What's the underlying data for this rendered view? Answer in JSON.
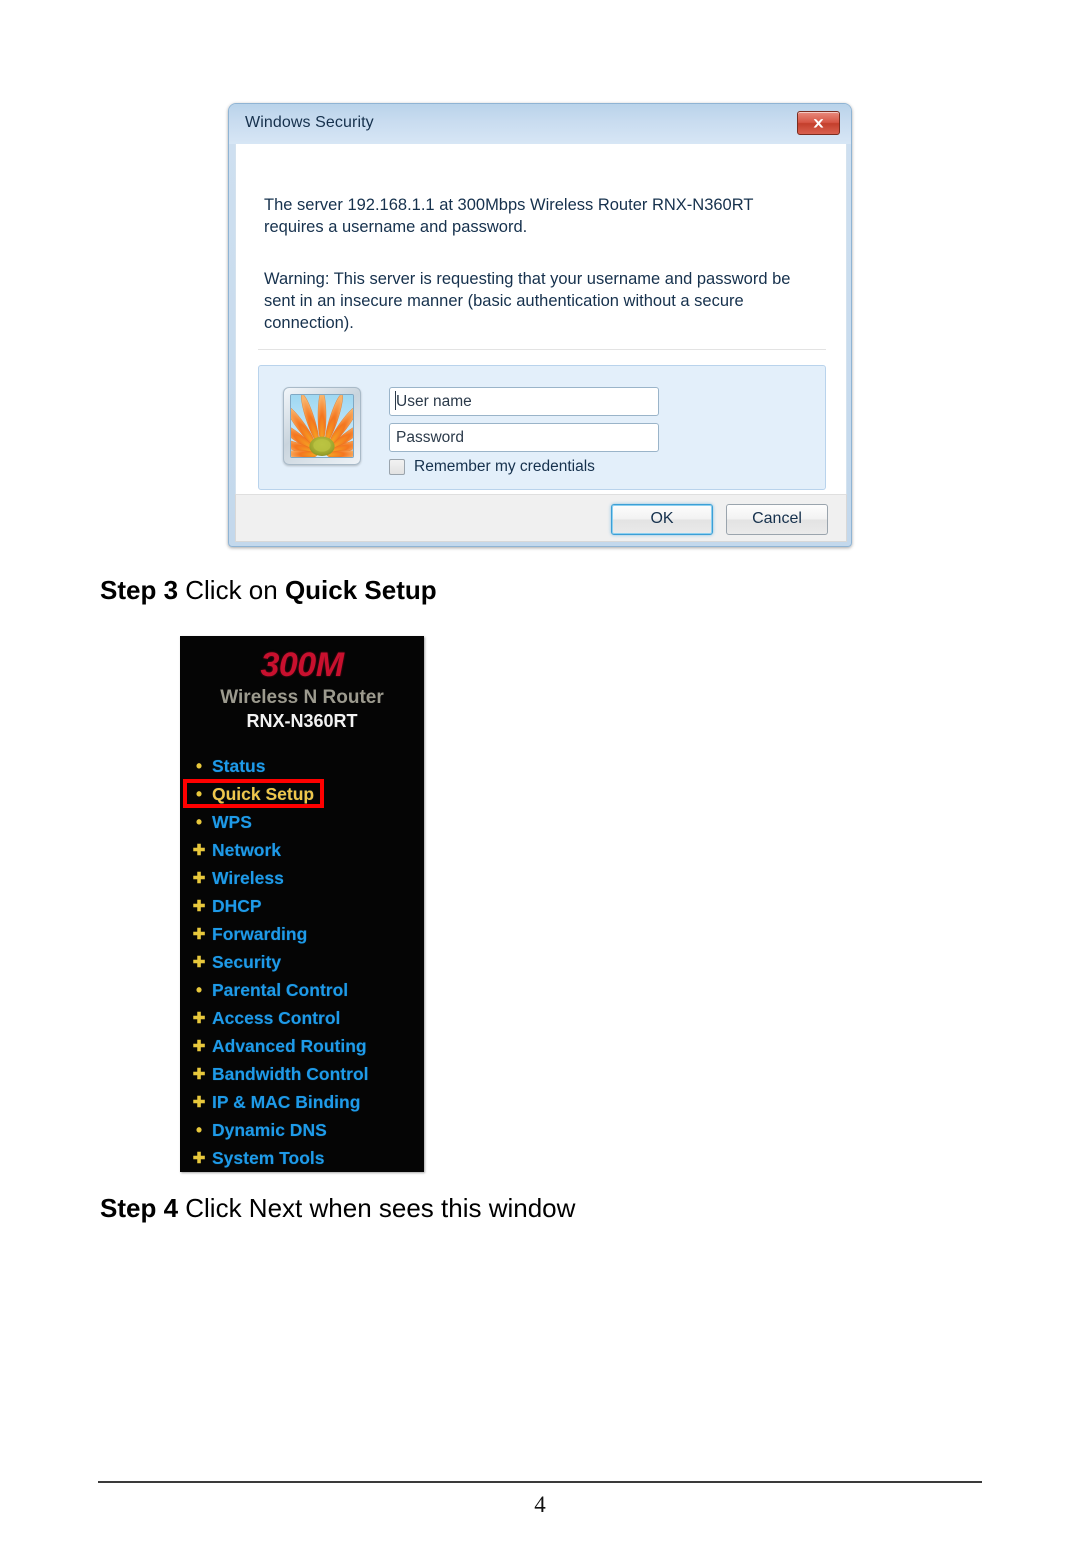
{
  "dialog": {
    "title": "Windows Security",
    "close_icon": "close-icon",
    "message_main": "The server 192.168.1.1 at 300Mbps Wireless Router RNX-N360RT requires a username and password.",
    "message_warning": "Warning: This server is requesting that your username and password be sent in an insecure manner (basic authentication without a secure connection).",
    "avatar_icon": "flower-avatar-icon",
    "username_placeholder": "User name",
    "username_value": "",
    "password_placeholder": "Password",
    "password_value": "",
    "remember_label": "Remember my credentials",
    "remember_checked": false,
    "ok_label": "OK",
    "cancel_label": "Cancel"
  },
  "steps": {
    "step3_prefix": "Step 3",
    "step3_text": " Click on ",
    "step3_target": "Quick Setup",
    "step4_prefix": "Step 4",
    "step4_text": " Click Next when sees this window"
  },
  "router": {
    "brand_speed": "300M",
    "brand_type": "Wireless N Router",
    "brand_model": "RNX-N360RT",
    "colors": {
      "speed": "#c8102e",
      "type": "#9c9a8e",
      "model": "#f2f2f2",
      "link": "#1e9ae8",
      "active": "#f0c64a",
      "bullet": "#e8c83c",
      "highlight": "#ff0000",
      "background": "#050505"
    },
    "menu": [
      {
        "label": "Status",
        "bullet": "dot",
        "active": false
      },
      {
        "label": "Quick Setup",
        "bullet": "dot",
        "active": true
      },
      {
        "label": "WPS",
        "bullet": "dot",
        "active": false
      },
      {
        "label": "Network",
        "bullet": "plus",
        "active": false
      },
      {
        "label": "Wireless",
        "bullet": "plus",
        "active": false
      },
      {
        "label": "DHCP",
        "bullet": "plus",
        "active": false
      },
      {
        "label": "Forwarding",
        "bullet": "plus",
        "active": false
      },
      {
        "label": "Security",
        "bullet": "plus",
        "active": false
      },
      {
        "label": "Parental Control",
        "bullet": "dot",
        "active": false
      },
      {
        "label": "Access Control",
        "bullet": "plus",
        "active": false
      },
      {
        "label": "Advanced Routing",
        "bullet": "plus",
        "active": false
      },
      {
        "label": "Bandwidth Control",
        "bullet": "plus",
        "active": false
      },
      {
        "label": "IP & MAC Binding",
        "bullet": "plus",
        "active": false
      },
      {
        "label": "Dynamic DNS",
        "bullet": "dot",
        "active": false
      },
      {
        "label": "System Tools",
        "bullet": "plus",
        "active": false
      }
    ]
  },
  "footer": {
    "page_number": "4"
  }
}
